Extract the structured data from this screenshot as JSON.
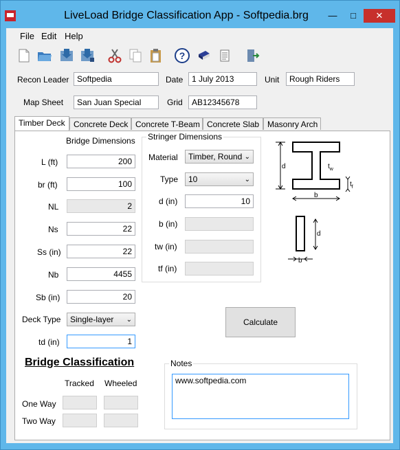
{
  "window": {
    "title": "LiveLoad Bridge Classification App - Softpedia.brg"
  },
  "menu": [
    "File",
    "Edit",
    "Help"
  ],
  "toolbar": [
    "new-file-icon",
    "open-folder-icon",
    "save-icon",
    "save-as-icon",
    "cut-icon",
    "copy-icon",
    "paste-icon",
    "help-icon",
    "book-icon",
    "document-icon",
    "exit-icon"
  ],
  "header": {
    "recon_leader_label": "Recon Leader",
    "recon_leader_value": "Softpedia",
    "date_label": "Date",
    "date_value": "1 July 2013",
    "unit_label": "Unit",
    "unit_value": "Rough Riders",
    "map_sheet_label": "Map Sheet",
    "map_sheet_value": "San Juan Special",
    "grid_label": "Grid",
    "grid_value": "AB12345678"
  },
  "tabs": [
    "Timber Deck",
    "Concrete Deck",
    "Concrete T-Beam",
    "Concrete Slab",
    "Masonry Arch"
  ],
  "bridge_dimensions": {
    "title": "Bridge Dimensions",
    "fields": [
      {
        "label": "L (ft)",
        "value": "200",
        "disabled": false
      },
      {
        "label": "br (ft)",
        "value": "100",
        "disabled": false
      },
      {
        "label": "NL",
        "value": "2",
        "disabled": true
      },
      {
        "label": "Ns",
        "value": "22",
        "disabled": false
      },
      {
        "label": "Ss (in)",
        "value": "22",
        "disabled": false
      },
      {
        "label": "Nb",
        "value": "4455",
        "disabled": false
      },
      {
        "label": "Sb (in)",
        "value": "20",
        "disabled": false
      }
    ],
    "deck_type_label": "Deck Type",
    "deck_type_value": "Single-layer",
    "td_label": "td (in)",
    "td_value": "1"
  },
  "stringer_dimensions": {
    "title": "Stringer Dimensions",
    "material_label": "Material",
    "material_value": "Timber, Round",
    "type_label": "Type",
    "type_value": "10",
    "d_label": "d (in)",
    "d_value": "10",
    "b_label": "b (in)",
    "tw_label": "tw (in)",
    "tf_label": "tf (in)"
  },
  "diagram_labels": {
    "d": "d",
    "tw": "t",
    "tw_sub": "w",
    "tf": "t",
    "tf_sub": "f",
    "b": "b"
  },
  "calculate_label": "Calculate",
  "classification": {
    "title": "Bridge Classification",
    "tracked_label": "Tracked",
    "wheeled_label": "Wheeled",
    "one_way_label": "One Way",
    "two_way_label": "Two Way"
  },
  "notes": {
    "label": "Notes",
    "value": "www.softpedia.com"
  }
}
